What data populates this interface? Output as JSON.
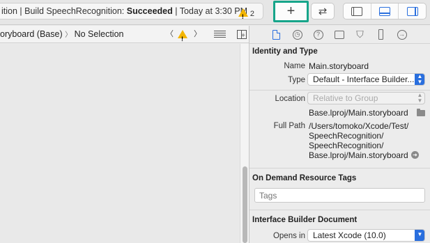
{
  "toolbar": {
    "activity_prefix": "ition | Build SpeechRecognition: ",
    "activity_status": "Succeeded",
    "activity_time": " | Today at 3:30 PM",
    "warning_count": "2",
    "library_label": "+",
    "swap_label": "⇄",
    "icons": [
      "plus-icon",
      "swap-arrows-icon",
      "left-pane-icon",
      "bottom-pane-icon",
      "right-pane-icon"
    ]
  },
  "jumpbar": {
    "path": "oryboard (Base)",
    "separator": "〉",
    "selection": "No Selection",
    "back": "〈",
    "forward": "〉"
  },
  "inspector": {
    "identity": {
      "title": "Identity and Type",
      "name_label": "Name",
      "name_value": "Main.storyboard",
      "type_label": "Type",
      "type_value": "Default - Interface Builder...",
      "location_label": "Location",
      "location_value": "Relative to Group",
      "location_path": "Base.lproj/Main.storyboard",
      "fullpath_label": "Full Path",
      "fullpath_lines": [
        "/Users/tomoko/Xcode/Test/",
        "SpeechRecognition/",
        "SpeechRecognition/",
        "Base.lproj/Main.storyboard"
      ]
    },
    "tags": {
      "title": "On Demand Resource Tags",
      "placeholder": "Tags"
    },
    "ib_document": {
      "title": "Interface Builder Document",
      "opens_in_label": "Opens in",
      "opens_in_value": "Latest Xcode (10.0)"
    }
  },
  "colors": {
    "accent": "#2a6fde",
    "highlight": "#16a58a",
    "warning": "#f3b500"
  }
}
